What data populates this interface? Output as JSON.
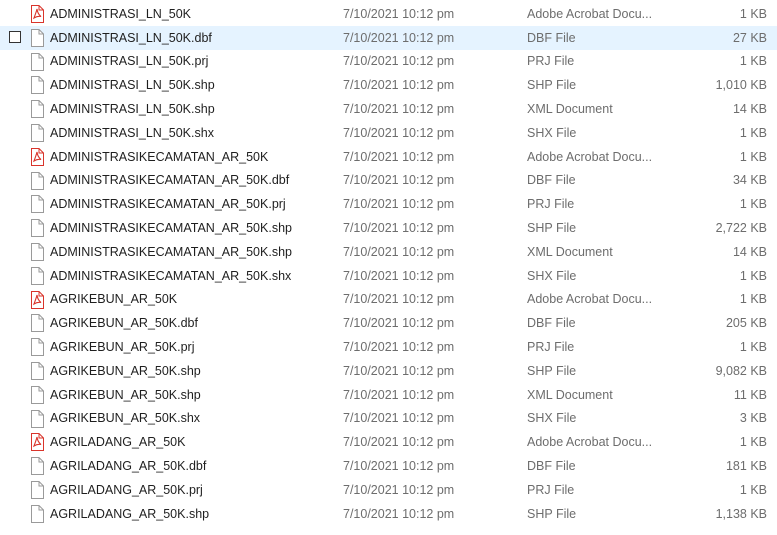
{
  "files": [
    {
      "name": "ADMINISTRASI_LN_50K",
      "date": "7/10/2021 10:12 pm",
      "type": "Adobe Acrobat Docu...",
      "size": "1 KB",
      "icon": "pdf-icon"
    },
    {
      "name": "ADMINISTRASI_LN_50K.dbf",
      "date": "7/10/2021 10:12 pm",
      "type": "DBF File",
      "size": "27 KB",
      "icon": "file-icon",
      "hover": true
    },
    {
      "name": "ADMINISTRASI_LN_50K.prj",
      "date": "7/10/2021 10:12 pm",
      "type": "PRJ File",
      "size": "1 KB",
      "icon": "file-icon"
    },
    {
      "name": "ADMINISTRASI_LN_50K.shp",
      "date": "7/10/2021 10:12 pm",
      "type": "SHP File",
      "size": "1,010 KB",
      "icon": "file-icon"
    },
    {
      "name": "ADMINISTRASI_LN_50K.shp",
      "date": "7/10/2021 10:12 pm",
      "type": "XML Document",
      "size": "14 KB",
      "icon": "file-icon"
    },
    {
      "name": "ADMINISTRASI_LN_50K.shx",
      "date": "7/10/2021 10:12 pm",
      "type": "SHX File",
      "size": "1 KB",
      "icon": "file-icon"
    },
    {
      "name": "ADMINISTRASIKECAMATAN_AR_50K",
      "date": "7/10/2021 10:12 pm",
      "type": "Adobe Acrobat Docu...",
      "size": "1 KB",
      "icon": "pdf-icon"
    },
    {
      "name": "ADMINISTRASIKECAMATAN_AR_50K.dbf",
      "date": "7/10/2021 10:12 pm",
      "type": "DBF File",
      "size": "34 KB",
      "icon": "file-icon"
    },
    {
      "name": "ADMINISTRASIKECAMATAN_AR_50K.prj",
      "date": "7/10/2021 10:12 pm",
      "type": "PRJ File",
      "size": "1 KB",
      "icon": "file-icon"
    },
    {
      "name": "ADMINISTRASIKECAMATAN_AR_50K.shp",
      "date": "7/10/2021 10:12 pm",
      "type": "SHP File",
      "size": "2,722 KB",
      "icon": "file-icon"
    },
    {
      "name": "ADMINISTRASIKECAMATAN_AR_50K.shp",
      "date": "7/10/2021 10:12 pm",
      "type": "XML Document",
      "size": "14 KB",
      "icon": "file-icon"
    },
    {
      "name": "ADMINISTRASIKECAMATAN_AR_50K.shx",
      "date": "7/10/2021 10:12 pm",
      "type": "SHX File",
      "size": "1 KB",
      "icon": "file-icon"
    },
    {
      "name": "AGRIKEBUN_AR_50K",
      "date": "7/10/2021 10:12 pm",
      "type": "Adobe Acrobat Docu...",
      "size": "1 KB",
      "icon": "pdf-icon"
    },
    {
      "name": "AGRIKEBUN_AR_50K.dbf",
      "date": "7/10/2021 10:12 pm",
      "type": "DBF File",
      "size": "205 KB",
      "icon": "file-icon"
    },
    {
      "name": "AGRIKEBUN_AR_50K.prj",
      "date": "7/10/2021 10:12 pm",
      "type": "PRJ File",
      "size": "1 KB",
      "icon": "file-icon"
    },
    {
      "name": "AGRIKEBUN_AR_50K.shp",
      "date": "7/10/2021 10:12 pm",
      "type": "SHP File",
      "size": "9,082 KB",
      "icon": "file-icon"
    },
    {
      "name": "AGRIKEBUN_AR_50K.shp",
      "date": "7/10/2021 10:12 pm",
      "type": "XML Document",
      "size": "11 KB",
      "icon": "file-icon"
    },
    {
      "name": "AGRIKEBUN_AR_50K.shx",
      "date": "7/10/2021 10:12 pm",
      "type": "SHX File",
      "size": "3 KB",
      "icon": "file-icon"
    },
    {
      "name": "AGRILADANG_AR_50K",
      "date": "7/10/2021 10:12 pm",
      "type": "Adobe Acrobat Docu...",
      "size": "1 KB",
      "icon": "pdf-icon"
    },
    {
      "name": "AGRILADANG_AR_50K.dbf",
      "date": "7/10/2021 10:12 pm",
      "type": "DBF File",
      "size": "181 KB",
      "icon": "file-icon"
    },
    {
      "name": "AGRILADANG_AR_50K.prj",
      "date": "7/10/2021 10:12 pm",
      "type": "PRJ File",
      "size": "1 KB",
      "icon": "file-icon"
    },
    {
      "name": "AGRILADANG_AR_50K.shp",
      "date": "7/10/2021 10:12 pm",
      "type": "SHP File",
      "size": "1,138 KB",
      "icon": "file-icon"
    }
  ],
  "colors": {
    "hover_bg": "#e5f3ff",
    "pdf_red": "#d9342b",
    "secondary_text": "#6d6d6d"
  }
}
